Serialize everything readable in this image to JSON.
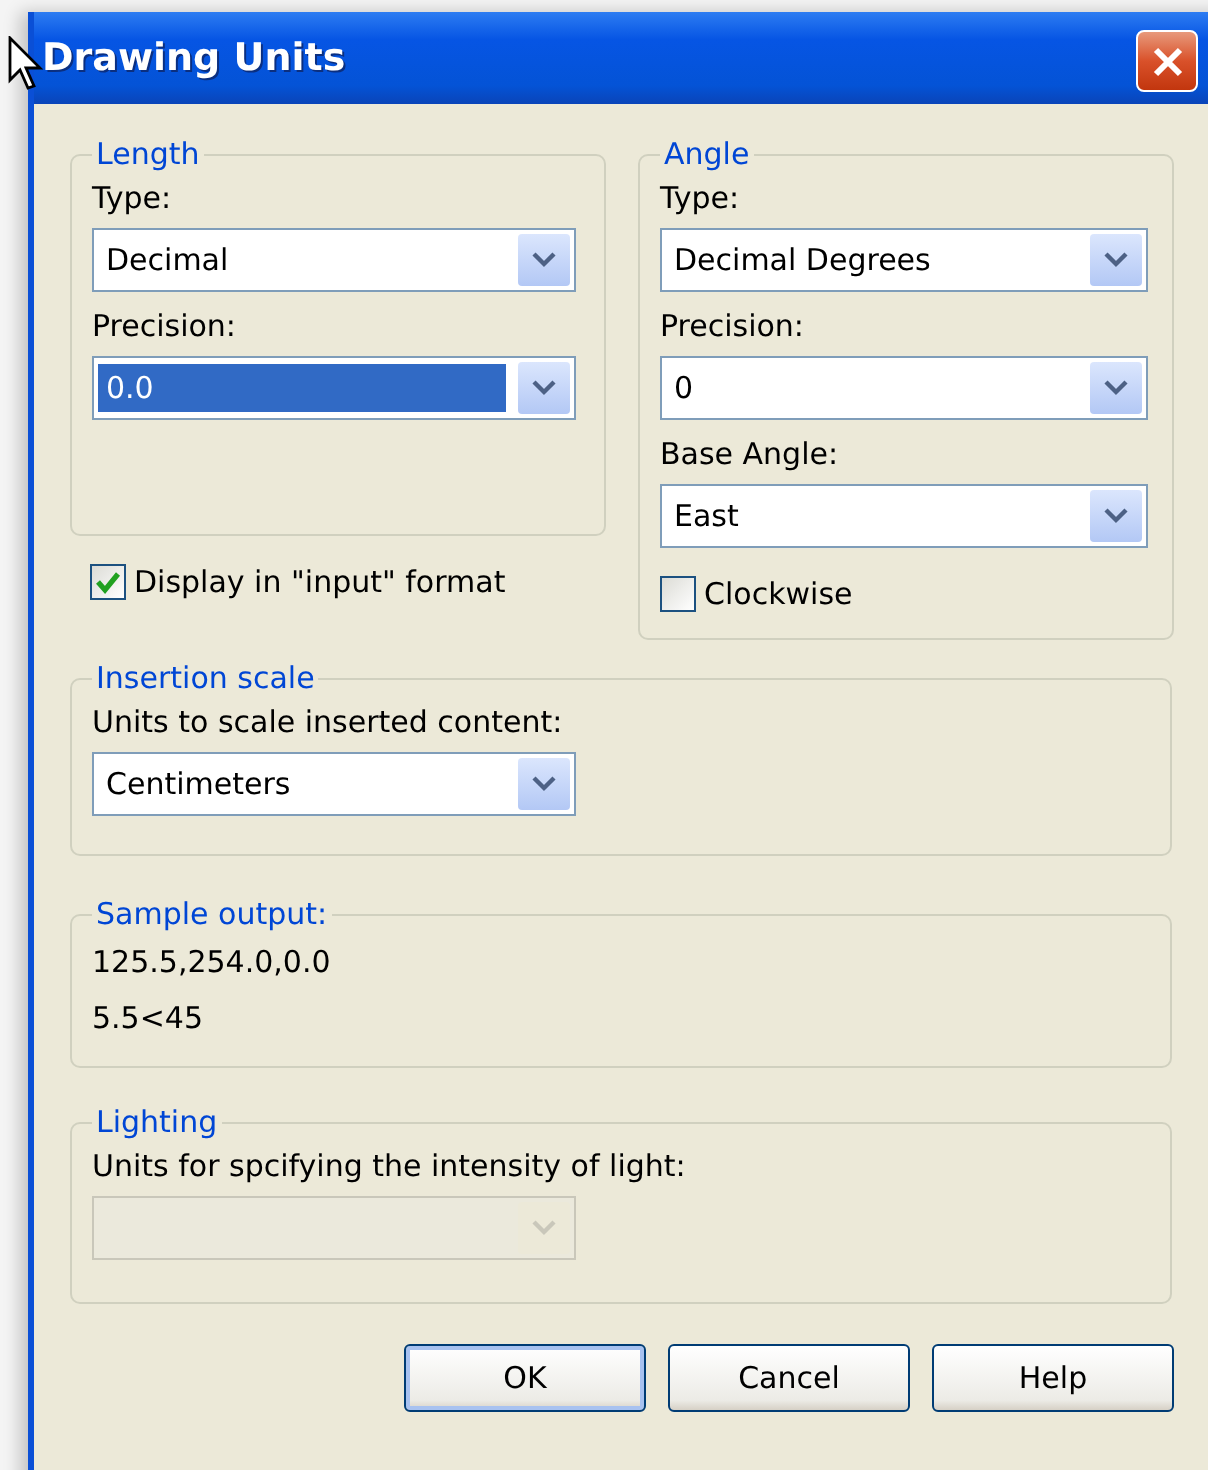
{
  "window": {
    "title": "Drawing Units"
  },
  "length": {
    "title": "Length",
    "fields": [
      {
        "label": "Type:",
        "value": "Decimal",
        "selected": false,
        "disabled": false
      },
      {
        "label": "Precision:",
        "value": "0.0",
        "selected": true,
        "disabled": false
      }
    ]
  },
  "display_input_format": {
    "label": "Display in \"input\" format",
    "checked": true
  },
  "angle": {
    "title": "Angle",
    "fields": [
      {
        "label": "Type:",
        "value": "Decimal Degrees",
        "selected": false,
        "disabled": false
      },
      {
        "label": "Precision:",
        "value": "0",
        "selected": false,
        "disabled": false
      },
      {
        "label": "Base Angle:",
        "value": "East",
        "selected": false,
        "disabled": false
      }
    ]
  },
  "clockwise": {
    "label": "Clockwise",
    "checked": false
  },
  "insertion_scale": {
    "title": "Insertion scale",
    "field": {
      "label": "Units to scale inserted content:",
      "value": "Centimeters",
      "selected": false,
      "disabled": false
    }
  },
  "sample_output": {
    "title": "Sample output:",
    "lines": [
      "125.5,254.0,0.0",
      "5.5<45"
    ]
  },
  "lighting": {
    "title": "Lighting",
    "field": {
      "label": "Units for spcifying the intensity of light:",
      "disabled": true
    }
  },
  "buttons": [
    {
      "label": "OK",
      "default": true
    },
    {
      "label": "Cancel",
      "default": false
    },
    {
      "label": "Help",
      "default": false
    }
  ]
}
